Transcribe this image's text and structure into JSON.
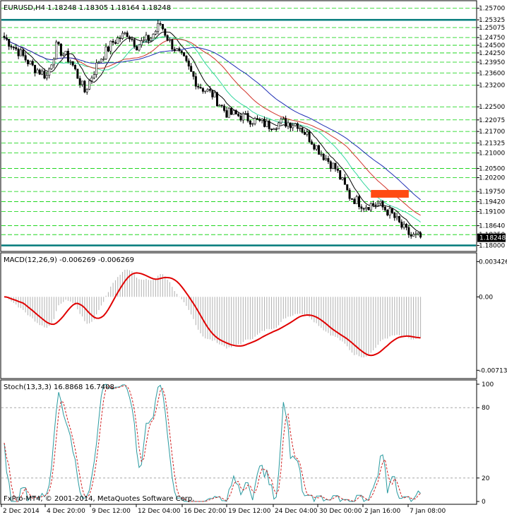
{
  "colors": {
    "background": "#ffffff",
    "grid": "#e6e6e6",
    "level_line": "#00d000",
    "strong_level": "#007a7a",
    "ma_fast": "#000000",
    "ma_green": "#35d6a0",
    "ma_red": "#d2352b",
    "ma_blue": "#1f2fb5",
    "macd_hist": "#b0b0b0",
    "macd_signal": "#e00000",
    "stoch_main": "#2a9aa0",
    "stoch_signal": "#d02020",
    "highlight_box": "#ff4a12"
  },
  "price_panel": {
    "title": "EURUSD,H4  1.18248 1.18305 1.18164 1.18248",
    "current_price": "1.18248",
    "price_labels": [
      "1.25700",
      "1.25325",
      "1.25075",
      "1.24750",
      "1.24500",
      "1.24250",
      "1.23950",
      "1.23600",
      "1.23200",
      "1.22500",
      "1.22075",
      "1.21700",
      "1.21325",
      "1.21000",
      "1.20500",
      "1.20200",
      "1.19750",
      "1.19420",
      "1.19100",
      "1.18640",
      "1.18350",
      "1.18000"
    ]
  },
  "macd_panel": {
    "title": "MACD(12,26,9) -0.006269 -0.006269",
    "scale_labels": [
      "0.003426",
      "0.00",
      "-0.007134"
    ]
  },
  "stoch_panel": {
    "title": "Stoch(13,3,3) 16.8868 16.7408",
    "scale_labels": [
      "100",
      "80",
      "20",
      "0"
    ]
  },
  "copyright": "FxPro-MT4, © 2001-2014, MetaQuotes Software Corp.",
  "time_labels": [
    "2 Dec 2014",
    "4 Dec 20:00",
    "9 Dec 12:00",
    "12 Dec 04:00",
    "16 Dec 20:00",
    "19 Dec 12:00",
    "24 Dec 04:00",
    "30 Dec 00:00",
    "2 Jan 16:00",
    "7 Jan 08:00"
  ]
}
